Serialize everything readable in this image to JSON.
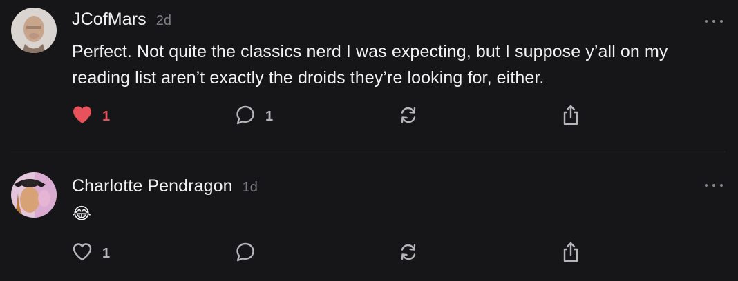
{
  "colors": {
    "background": "#161619",
    "text": "#f2f2f2",
    "muted": "#7d7d83",
    "like_active": "#e8525a",
    "divider": "#2e2e33"
  },
  "comments": [
    {
      "author": "JCofMars",
      "time": "2d",
      "text": "Perfect. Not quite the classics nerd I was expecting, but I suppose y’all on my reading list aren’t exactly the droids they’re looking for, either.",
      "liked": true,
      "likes": "1",
      "replies": "1",
      "icons": {
        "like": "heart-filled-icon",
        "reply": "speech-bubble-icon",
        "restack": "restack-icon",
        "share": "share-icon",
        "more": "more-dots-icon"
      }
    },
    {
      "author": "Charlotte Pendragon",
      "time": "1d",
      "text": "😂",
      "liked": false,
      "likes": "1",
      "replies": "",
      "icons": {
        "like": "heart-outline-icon",
        "reply": "speech-bubble-icon",
        "restack": "restack-icon",
        "share": "share-icon",
        "more": "more-dots-icon"
      }
    }
  ]
}
